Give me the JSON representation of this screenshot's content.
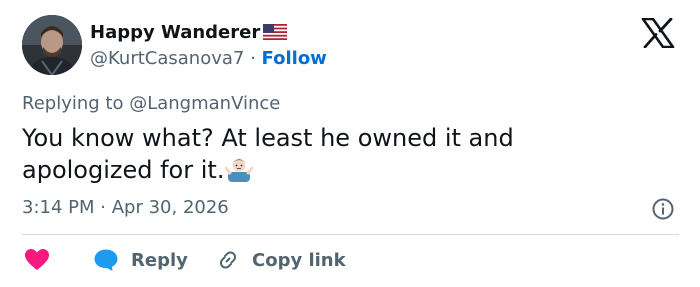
{
  "author": {
    "display_name": "Happy Wanderer",
    "flag": "us-flag-icon",
    "handle": "@KurtCasanova7",
    "separator": "·",
    "follow_label": "Follow"
  },
  "platform_icon": "x-logo-icon",
  "reply_context": {
    "prefix": "Replying to",
    "mention": "@LangmanVince"
  },
  "tweet": {
    "text": "You know what? At least he owned it and apologized for it.",
    "emoji": "person-shrugging-icon"
  },
  "meta": {
    "time": "3:14 PM",
    "separator": "·",
    "date": "Apr 30, 2026"
  },
  "actions": {
    "like_icon": "heart-icon",
    "reply_label": "Reply",
    "copy_label": "Copy link"
  },
  "colors": {
    "accent_blue": "#1d9bf0",
    "follow_blue": "#006fd6",
    "like_red": "#f91880",
    "secondary_text": "#536471",
    "divider": "#cfd9de"
  }
}
